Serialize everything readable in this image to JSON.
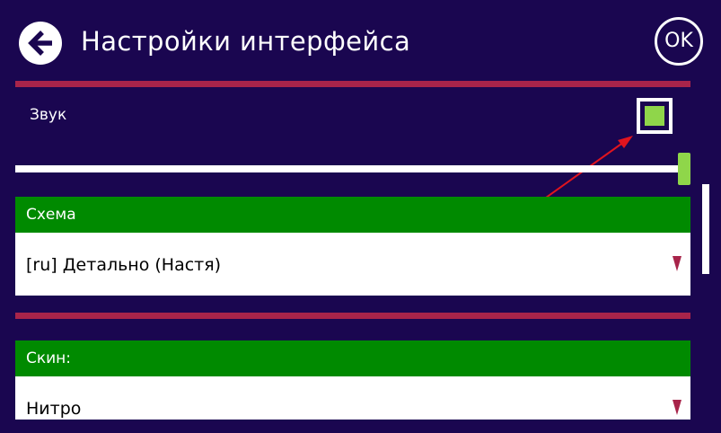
{
  "header": {
    "title": "Настройки интерфейса",
    "back_icon": "arrow-left-circle-icon",
    "ok_label": "OK"
  },
  "sound": {
    "label": "Звук",
    "checked": true,
    "volume_level": 1.0
  },
  "scheme": {
    "header": "Схема",
    "selected": "[ru] Детально (Настя)"
  },
  "skin": {
    "header": "Скин:",
    "selected": "Нитро"
  },
  "colors": {
    "background": "#1a0650",
    "divider": "#a8244a",
    "section_header": "#008a00",
    "accent_green": "#8fd64a",
    "dropdown_arrow": "#a8244a",
    "annotation_arrow": "#e0141e"
  }
}
